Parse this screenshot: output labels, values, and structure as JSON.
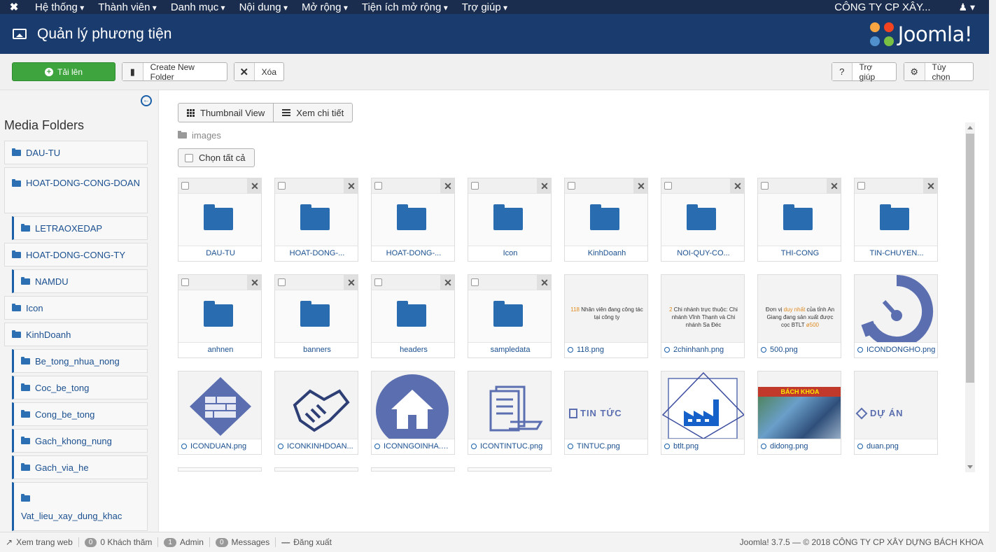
{
  "topnav": {
    "menu": [
      "Hệ thống",
      "Thành viên",
      "Danh mục",
      "Nội dung",
      "Mở rộng",
      "Tiện ích mở rộng",
      "Trợ giúp"
    ],
    "company": "CÔNG TY CP XÂY...",
    "user_icon": "user-icon"
  },
  "header": {
    "title": "Quản lý phương tiện",
    "logo_text": "Joomla!"
  },
  "toolbar": {
    "upload": "Tải lên",
    "new_folder": "Create New Folder",
    "delete": "Xóa",
    "help": "Trợ giúp",
    "options": "Tùy chọn"
  },
  "sidebar": {
    "title": "Media Folders",
    "folders": [
      {
        "label": "DAU-TU",
        "level": 0
      },
      {
        "label": "HOAT-DONG-CONG-DOAN",
        "level": 0
      },
      {
        "label": "LETRAOXEDAP",
        "level": 1
      },
      {
        "label": "HOAT-DONG-CONG-TY",
        "level": 0
      },
      {
        "label": "NAMDU",
        "level": 1
      },
      {
        "label": "Icon",
        "level": 0
      },
      {
        "label": "KinhDoanh",
        "level": 0
      },
      {
        "label": "Be_tong_nhua_nong",
        "level": 1
      },
      {
        "label": "Coc_be_tong",
        "level": 1
      },
      {
        "label": "Cong_be_tong",
        "level": 1
      },
      {
        "label": "Gach_khong_nung",
        "level": 1
      },
      {
        "label": "Gach_via_he",
        "level": 1
      },
      {
        "label": "Vat_lieu_xay_dung_khac",
        "level": 1
      }
    ]
  },
  "main": {
    "tab_thumbnail": "Thumbnail View",
    "tab_detail": "Xem chi tiết",
    "breadcrumb": "images",
    "select_all": "Chọn tất cả",
    "items": [
      {
        "name": "DAU-TU",
        "type": "folder"
      },
      {
        "name": "HOAT-DONG-...",
        "type": "folder"
      },
      {
        "name": "HOAT-DONG-...",
        "type": "folder"
      },
      {
        "name": "Icon",
        "type": "folder"
      },
      {
        "name": "KinhDoanh",
        "type": "folder"
      },
      {
        "name": "NOI-QUY-CO...",
        "type": "folder"
      },
      {
        "name": "THI-CONG",
        "type": "folder"
      },
      {
        "name": "TIN-CHUYEN...",
        "type": "folder"
      },
      {
        "name": "anhnen",
        "type": "folder"
      },
      {
        "name": "banners",
        "type": "folder"
      },
      {
        "name": "headers",
        "type": "folder"
      },
      {
        "name": "sampledata",
        "type": "folder"
      },
      {
        "name": "118.png",
        "type": "image",
        "preview": "text118",
        "text": "Nhân viên đang công tác tại công ty",
        "num": "118"
      },
      {
        "name": "2chinhanh.png",
        "type": "image",
        "preview": "text2",
        "text": "Chi nhánh trực thuộc: Chi nhánh Vĩnh Thạnh và Chi nhánh Sa Đéc",
        "num": "2"
      },
      {
        "name": "500.png",
        "type": "image",
        "preview": "text500",
        "text1": "Đơn vị",
        "text2": "duy nhất",
        "text3": "của tỉnh An Giang đang sản xuất được cọc BTLT",
        "text4": "ø500"
      },
      {
        "name": "ICONDONGHO.png",
        "type": "image",
        "preview": "clock"
      },
      {
        "name": "ICONDUAN.png",
        "type": "image",
        "preview": "brick"
      },
      {
        "name": "ICONKINHDOAN...",
        "type": "image",
        "preview": "handshake"
      },
      {
        "name": "ICONNGOINHA.png",
        "type": "image",
        "preview": "house"
      },
      {
        "name": "ICONTINTUC.png",
        "type": "image",
        "preview": "docs"
      },
      {
        "name": "TINTUC.png",
        "type": "image",
        "preview": "tintuc",
        "label": "TIN TỨC"
      },
      {
        "name": "btlt.png",
        "type": "image",
        "preview": "factory"
      },
      {
        "name": "didong.png",
        "type": "image",
        "preview": "photo",
        "label": "BÁCH KHOA"
      },
      {
        "name": "duan.png",
        "type": "image",
        "preview": "duan",
        "label": "DỰ ÁN"
      }
    ]
  },
  "status": {
    "view_site": "Xem trang web",
    "visitors_count": "0",
    "visitors": "0 Khách thăm",
    "admin_count": "1",
    "admin": "Admin",
    "messages_count": "0",
    "messages": "Messages",
    "logout": "Đăng xuất",
    "footer": "Joomla! 3.7.5 — © 2018 CÔNG TY CP XÂY DỰNG BÁCH KHOA"
  },
  "colors": {
    "nav": "#1a2d4f",
    "header": "#1a3b6e",
    "accent": "#2a6cb0",
    "upload": "#3ea43e"
  }
}
